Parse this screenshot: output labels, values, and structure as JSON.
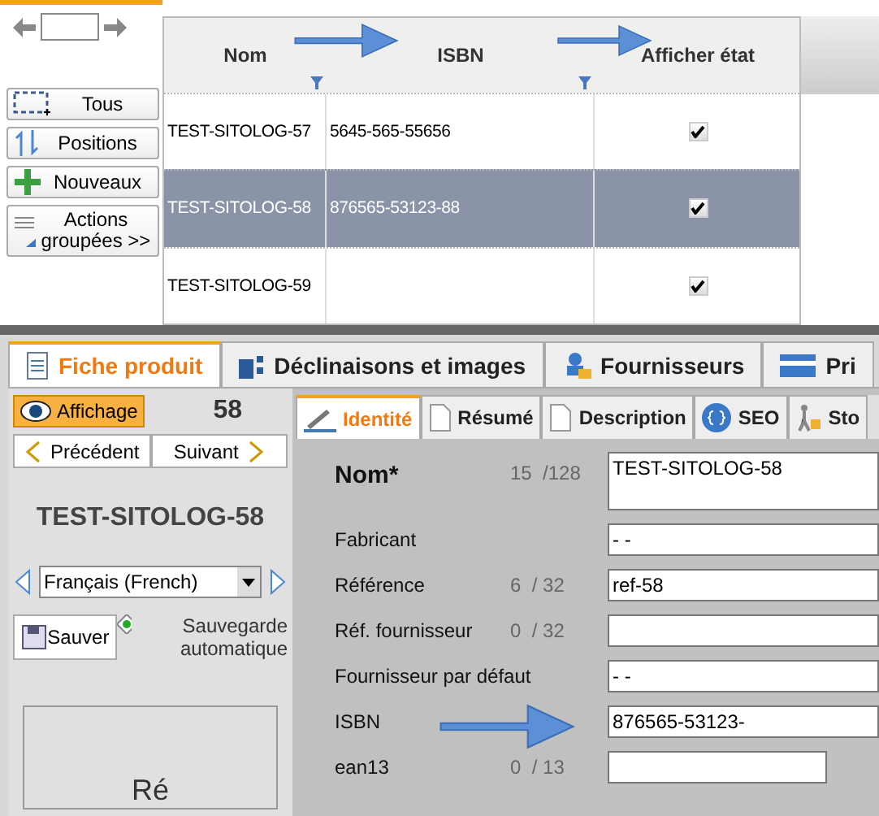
{
  "list_panel": {
    "buttons": [
      {
        "label": "Tous",
        "kind": "select"
      },
      {
        "label": "Positions",
        "kind": "positions"
      },
      {
        "label": "Nouveaux",
        "kind": "new"
      },
      {
        "label": "Actions groupées >>",
        "kind": "group"
      }
    ]
  },
  "table": {
    "columns": [
      "Nom",
      "ISBN",
      "Afficher état"
    ],
    "rows": [
      {
        "nom": "TEST-SITOLOG-57",
        "isbn": "5645-565-55656",
        "show": true,
        "selected": false
      },
      {
        "nom": "TEST-SITOLOG-58",
        "isbn": "876565-53123-88",
        "show": true,
        "selected": true
      },
      {
        "nom": "TEST-SITOLOG-59",
        "isbn": "",
        "show": true,
        "selected": false
      }
    ]
  },
  "tabs": [
    {
      "label": "Fiche produit",
      "selected": true,
      "kind": "doc"
    },
    {
      "label": "Déclinaisons et images",
      "selected": false,
      "kind": "grid"
    },
    {
      "label": "Fournisseurs",
      "selected": false,
      "kind": "person"
    },
    {
      "label": "Pri",
      "selected": false,
      "kind": "card"
    }
  ],
  "side": {
    "view_button": "Affichage",
    "id": "58",
    "prev": "Précédent",
    "next": "Suivant",
    "title": "TEST-SITOLOG-58",
    "language": "Français (French)",
    "save": "Sauver",
    "autosave": {
      "label": "Sauvegarde automatique",
      "checked": true
    },
    "preview_text": "Ré"
  },
  "subtabs": [
    {
      "label": "Identité",
      "selected": true,
      "kind": "pen"
    },
    {
      "label": "Résumé",
      "selected": false,
      "kind": "html"
    },
    {
      "label": "Description",
      "selected": false,
      "kind": "html"
    },
    {
      "label": "SEO",
      "selected": false,
      "kind": "seo"
    },
    {
      "label": "Sto",
      "selected": false,
      "kind": "stock"
    }
  ],
  "fields": [
    {
      "label": "Nom*",
      "count": "15",
      "max": "/128",
      "value": "TEST-SITOLOG-58",
      "kind": "tall"
    },
    {
      "label": "Fabricant",
      "value": "- -",
      "kind": "normal"
    },
    {
      "label": "Référence",
      "count": "6",
      "max": "/ 32",
      "value": "ref-58",
      "kind": "normal"
    },
    {
      "label": "Réf. fournisseur",
      "count": "0",
      "max": "/ 32",
      "kind": "normal"
    },
    {
      "label": "Fournisseur par défaut",
      "value": "- -",
      "kind": "normal"
    },
    {
      "label": "ISBN",
      "value": "876565-53123-",
      "kind": "normal"
    },
    {
      "label": "ean13",
      "count": "0",
      "max": "/ 13",
      "kind": "short"
    }
  ]
}
